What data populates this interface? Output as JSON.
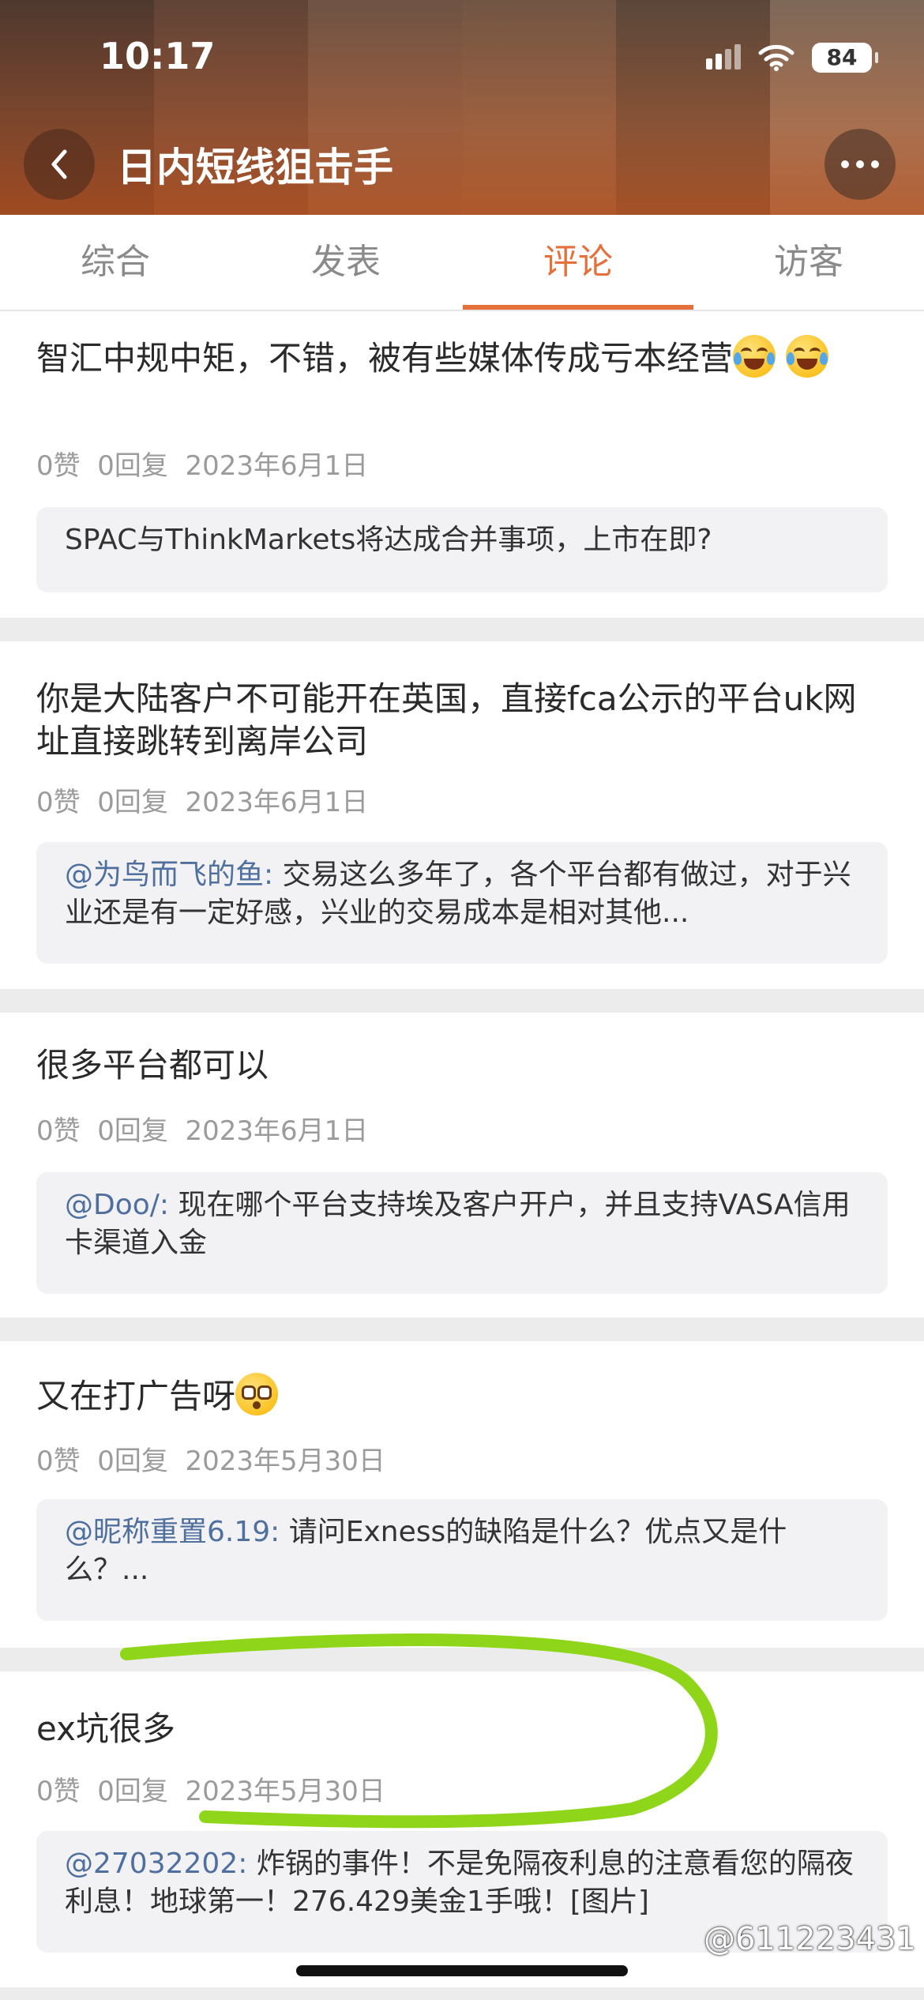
{
  "status_bar": {
    "time": "10:17",
    "battery": "84"
  },
  "header": {
    "title": "日内短线狙击手"
  },
  "tabs": [
    {
      "label": "综合"
    },
    {
      "label": "发表"
    },
    {
      "label": "评论"
    },
    {
      "label": "访客"
    }
  ],
  "active_tab": "评论",
  "posts": [
    {
      "text": "智汇中规中矩，不错，被有些媒体传成亏本经营",
      "meta": "0赞  0回复  2023年6月1日",
      "quote_user": "",
      "quote_text": "SPAC与ThinkMarkets将达成合并事项，上市在即?"
    },
    {
      "text": "你是大陆客户不可能开在英国，直接fca公示的平台uk网址直接跳转到离岸公司",
      "meta": "0赞  0回复  2023年6月1日",
      "quote_user": "@为鸟而飞的鱼:",
      "quote_text": "交易这么多年了，各个平台都有做过，对于兴业还是有一定好感，兴业的交易成本是相对其他..."
    },
    {
      "text": "很多平台都可以",
      "meta": "0赞  0回复  2023年6月1日",
      "quote_user": "@Doo/:",
      "quote_text": "现在哪个平台支持埃及客户开户，并且支持VASA信用卡渠道入金"
    },
    {
      "text": "又在打广告呀",
      "meta": "0赞  0回复  2023年5月30日",
      "quote_user": "@昵称重置6.19:",
      "quote_text": "请问Exness的缺陷是什么？优点又是什么？..."
    },
    {
      "text": "ex坑很多",
      "meta": "0赞  0回复  2023年5月30日",
      "quote_user": "@27032202:",
      "quote_text": "炸锅的事件！不是免隔夜利息的注意看您的隔夜利息！地球第一！276.429美金1手哦！[图片]"
    }
  ],
  "watermark": "@611223431",
  "colors": {
    "accent": "#e4713b",
    "mention": "#4f6f9e",
    "annotation": "#8fd61a"
  },
  "icons": [
    "back-chevron-icon",
    "more-dots-icon",
    "signal-icon",
    "wifi-icon",
    "battery-icon",
    "tears-of-joy-emoji",
    "flushed-face-emoji"
  ]
}
